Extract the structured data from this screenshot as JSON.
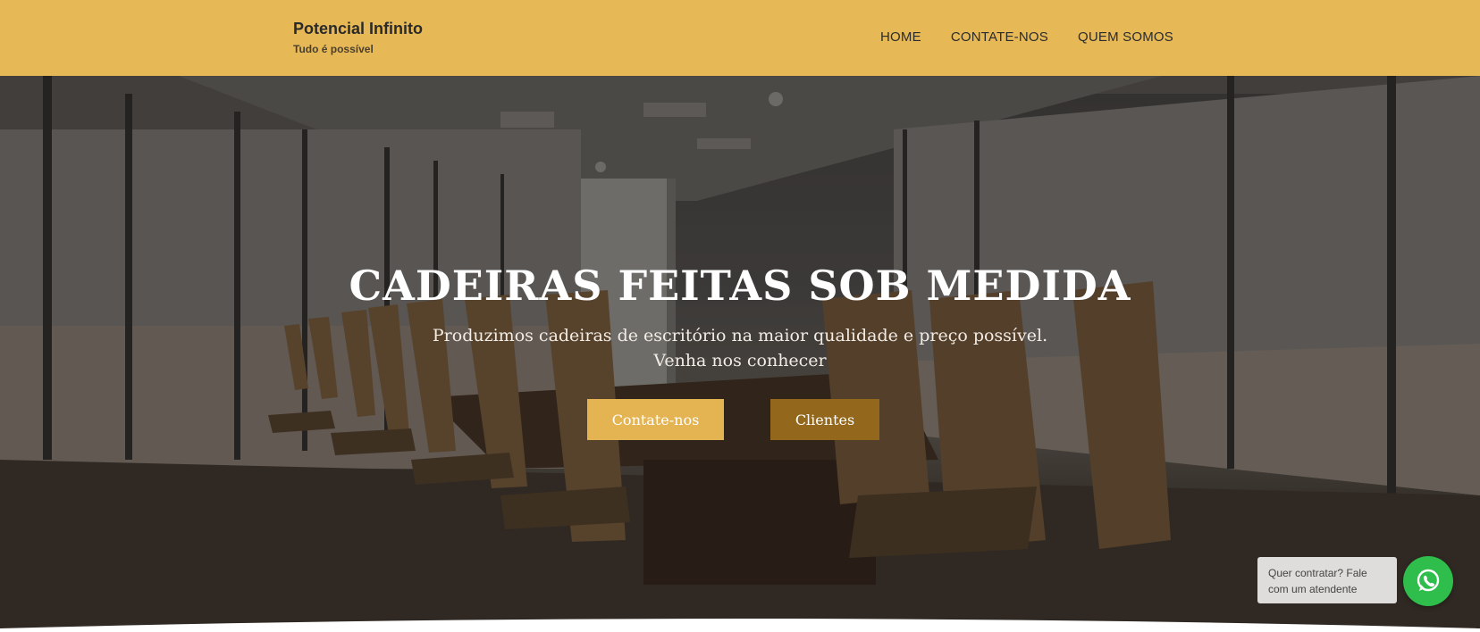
{
  "header": {
    "brand_name": "Potencial Infinito",
    "brand_tagline": "Tudo é possível",
    "nav": [
      "HOME",
      "CONTATE-NOS",
      "QUEM SOMOS"
    ]
  },
  "hero": {
    "title": "CADEIRAS FEITAS SOB MEDIDA",
    "subtitle_line1": "Produzimos cadeiras de escritório na maior qualidade e preço possível.",
    "subtitle_line2": "Venha nos conhecer",
    "primary_button": "Contate-nos",
    "secondary_button": "Clientes"
  },
  "chat_widget": {
    "message": "Quer contratar? Fale com um atendente",
    "icon": "whatsapp-icon"
  },
  "colors": {
    "header_bg": "#e7b856",
    "primary_button_bg": "#e4b453",
    "secondary_button_bg": "#93681d",
    "whatsapp_green": "#2fbd4b"
  }
}
